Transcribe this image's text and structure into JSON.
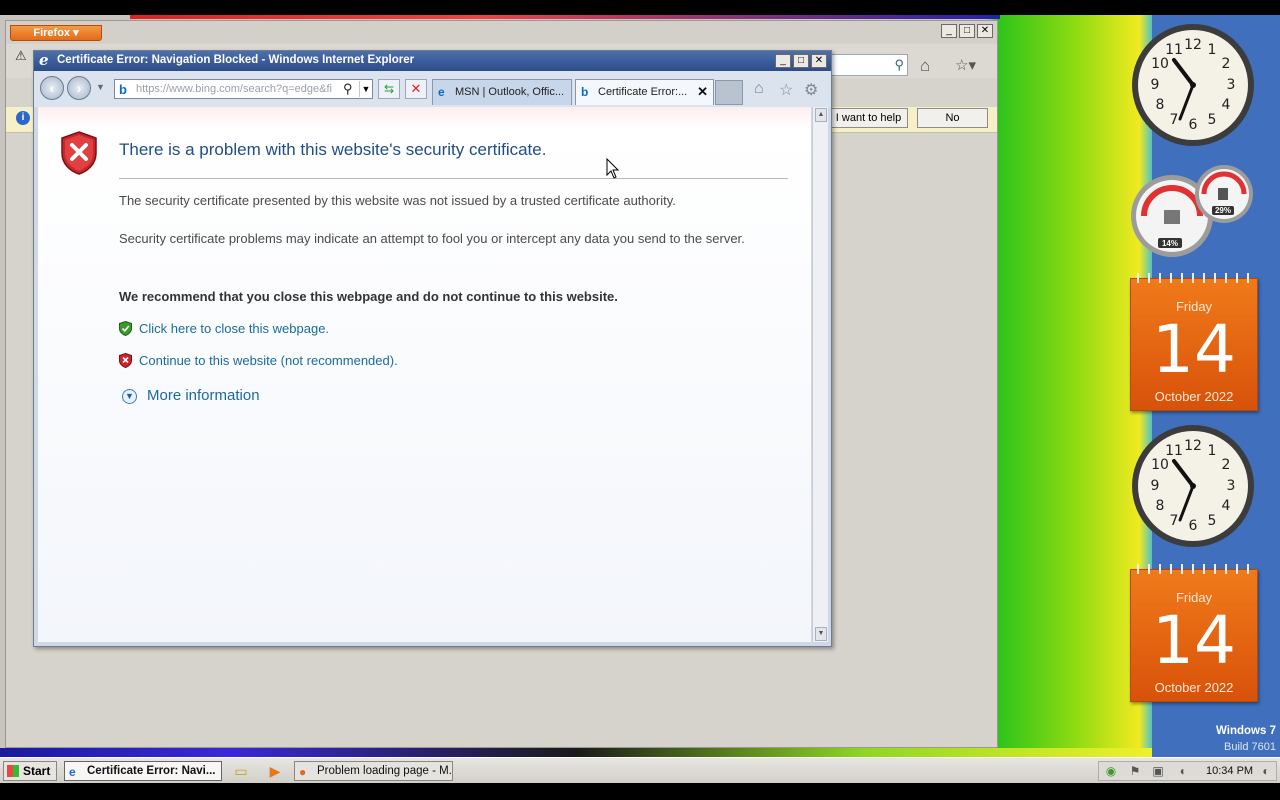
{
  "firefox": {
    "menu_label": "Firefox ▾",
    "help_button": "I want to help",
    "no_button": "No"
  },
  "ie": {
    "window_title": "Certificate Error: Navigation Blocked - Windows Internet Explorer",
    "address": "https://www.bing.com/search?q=edge&fi",
    "tabs": [
      {
        "label": "MSN | Outlook, Offic..."
      },
      {
        "label": "Certificate Error:..."
      }
    ],
    "heading": "There is a problem with this website's security certificate.",
    "paragraph1": "The security certificate presented by this website was not issued by a trusted certificate authority.",
    "paragraph2": "Security certificate problems may indicate an attempt to fool you or intercept any data you send to the server.",
    "recommendation": "We recommend that you close this webpage and do not continue to this website.",
    "close_link": "Click here to close this webpage.",
    "continue_link": "Continue to this website (not recommended).",
    "more_info": "More information"
  },
  "gadgets": {
    "cpu_percent": "14%",
    "ram_percent": "29%",
    "calendar": {
      "day": "Friday",
      "date": "14",
      "month": "October 2022"
    },
    "os_name": "Windows 7",
    "build": "Build 7601"
  },
  "taskbar": {
    "start_label": "Start",
    "ie_task": "Certificate Error: Navi...",
    "ff_task": "Problem loading page - M...",
    "clock": "10:34 PM"
  },
  "colors": {
    "ie_title_bar": "#2c4c8a",
    "heading_color": "#1f4d85",
    "link_color": "#1a6a9e",
    "error_red": "#c8262a",
    "safe_green": "#3a9a2a",
    "calendar_orange": "#e4661a"
  }
}
